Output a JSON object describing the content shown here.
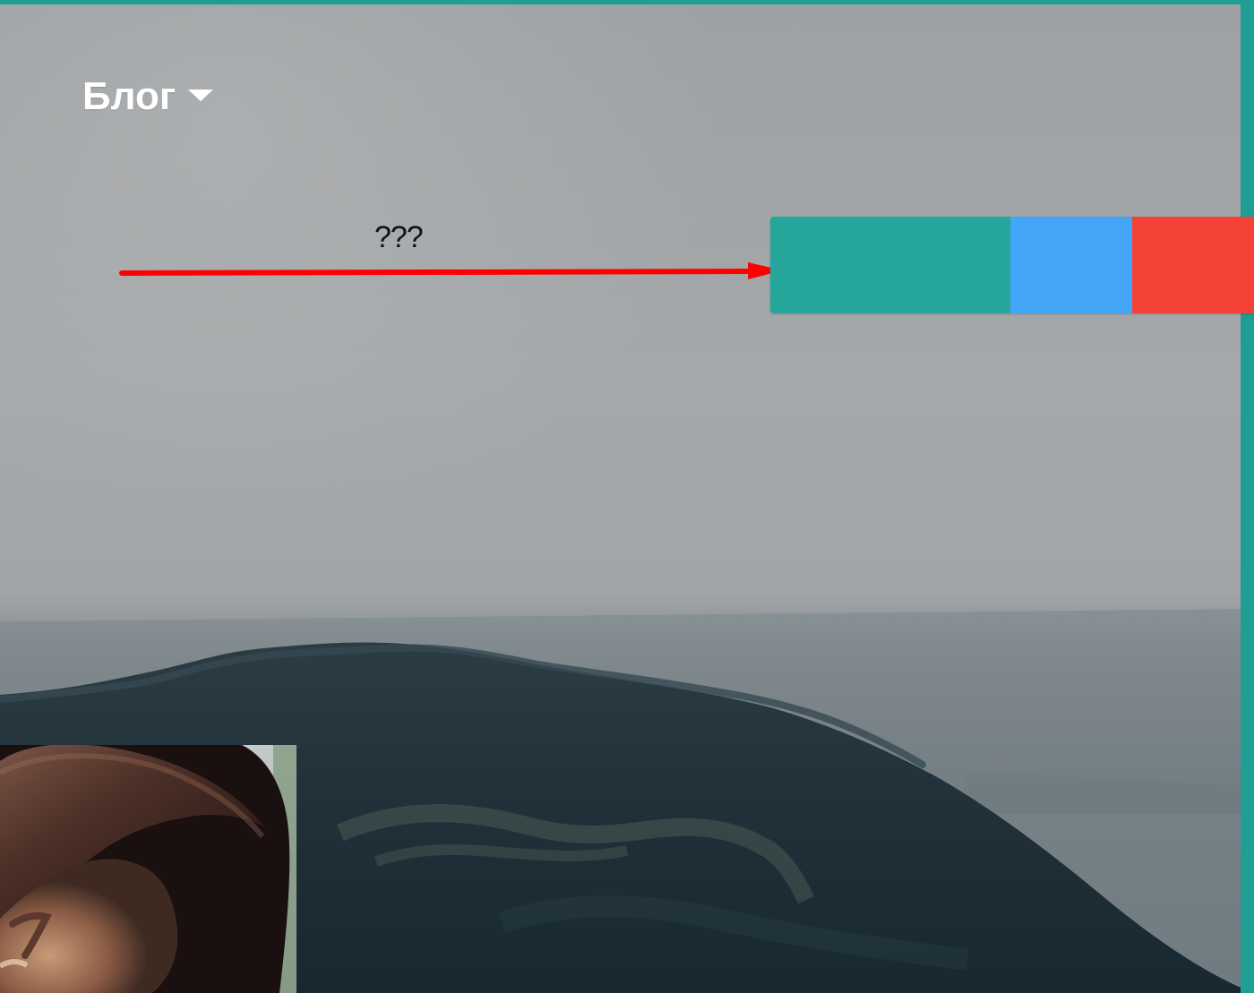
{
  "header": {
    "menu_label": "Блог"
  },
  "annotation": {
    "text": "???"
  },
  "icons": {
    "menu_caret": "chevron-down-icon",
    "annotation_arrow": "arrow-right-icon"
  },
  "color_bar": {
    "segments": [
      {
        "name": "teal",
        "color": "#26a69a"
      },
      {
        "name": "blue",
        "color": "#42a5f5"
      },
      {
        "name": "red",
        "color": "#f44336"
      }
    ]
  },
  "colors": {
    "frame_accent": "#1f9e94",
    "annotation_arrow": "#ff0000",
    "background": "#a2a5a7"
  }
}
